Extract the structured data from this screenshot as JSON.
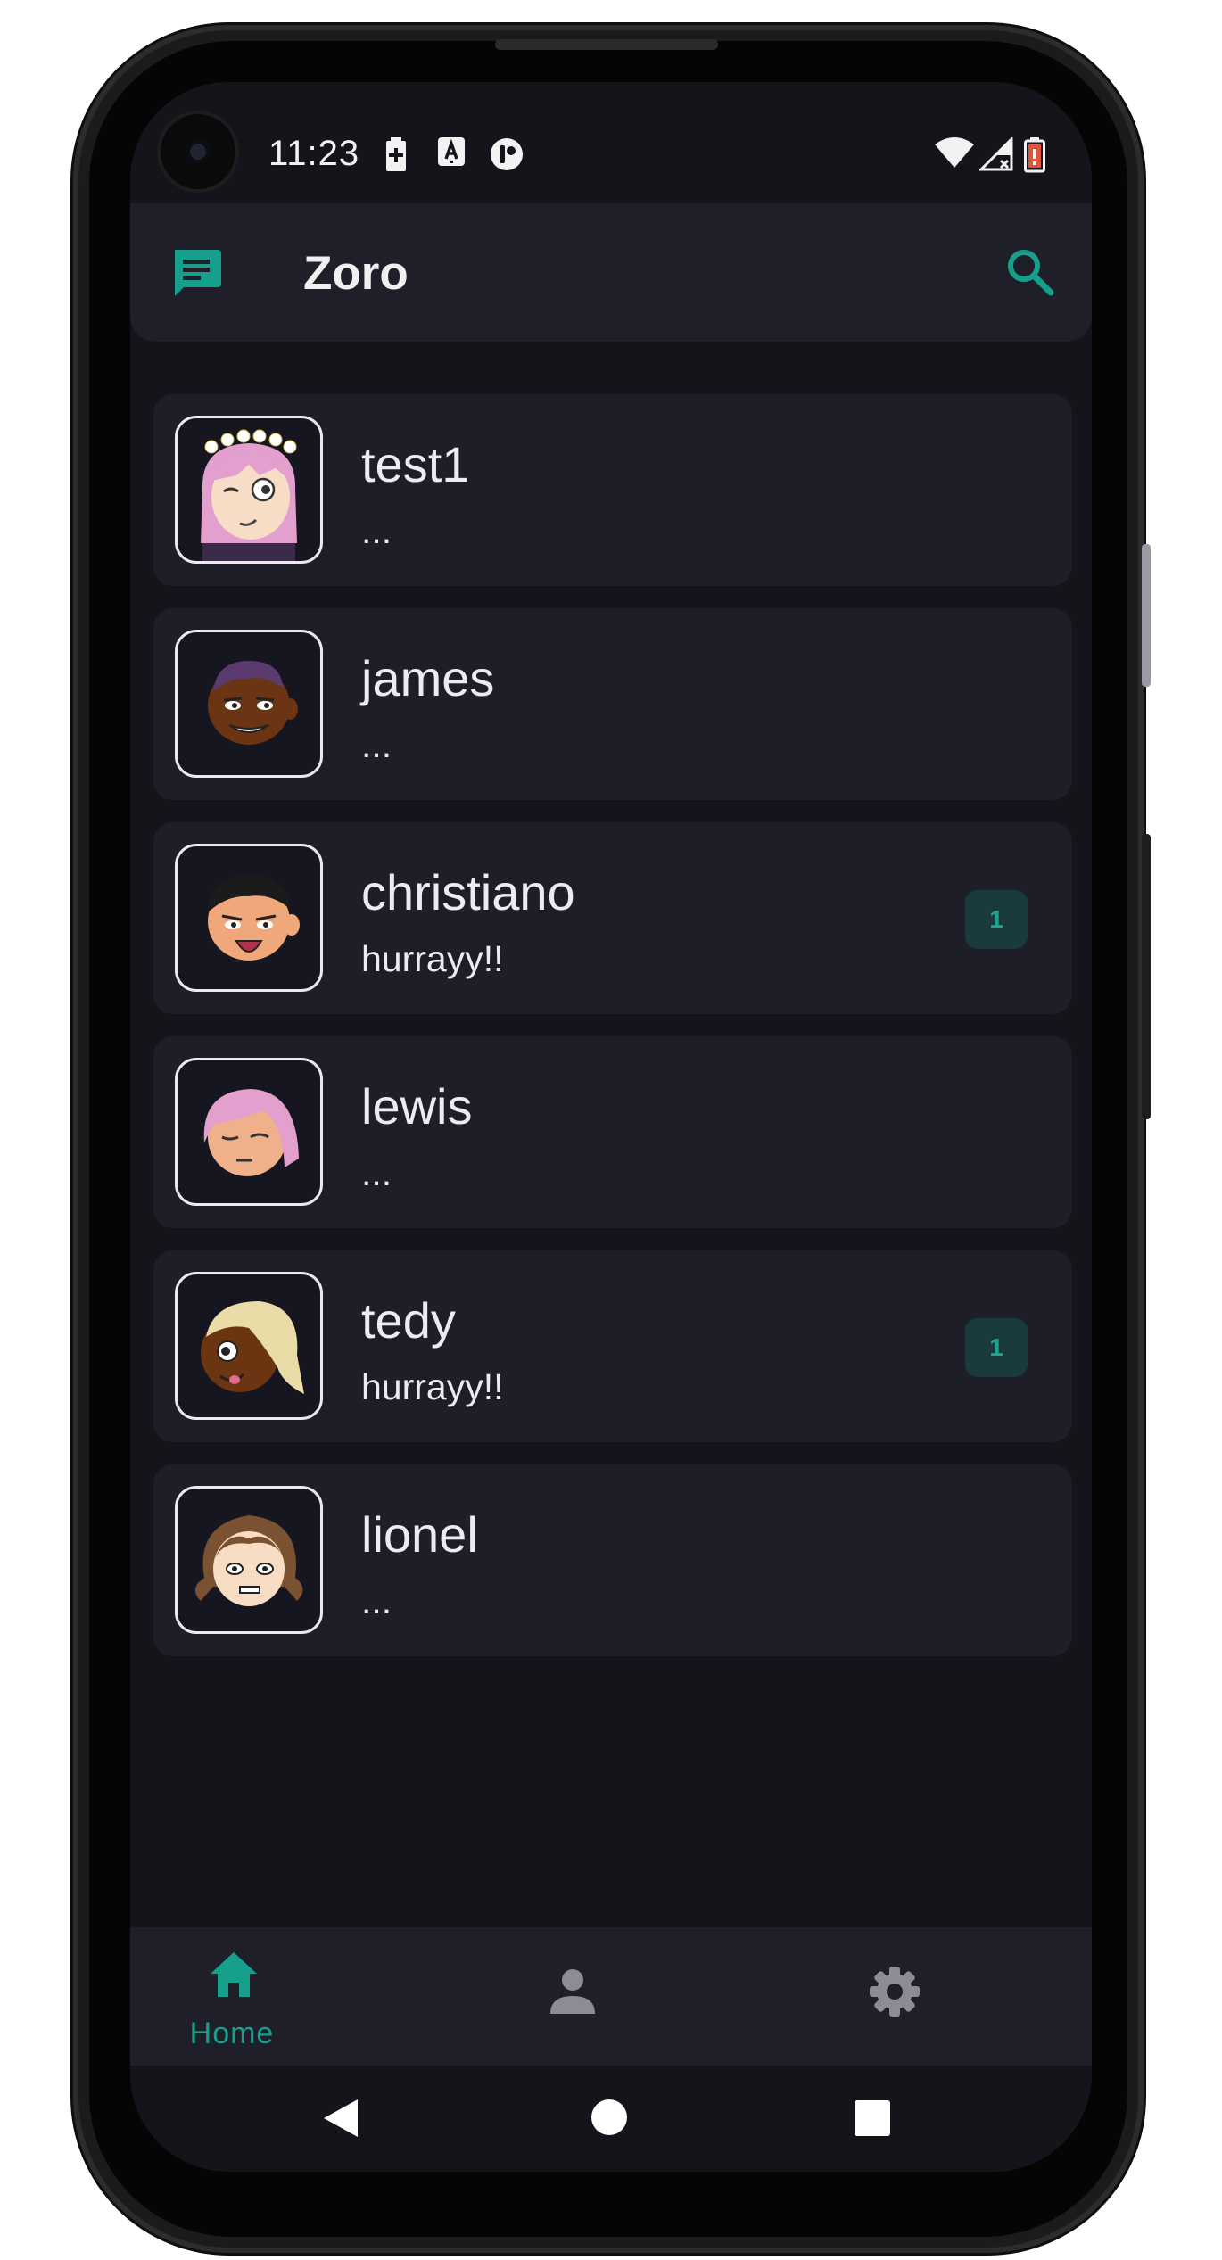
{
  "status_bar": {
    "time": "11:23"
  },
  "app_bar": {
    "title": "Zoro"
  },
  "chats": [
    {
      "name": "test1",
      "preview": "...",
      "unread": ""
    },
    {
      "name": "james",
      "preview": "...",
      "unread": ""
    },
    {
      "name": "christiano",
      "preview": "hurrayy!!",
      "unread": "1"
    },
    {
      "name": "lewis",
      "preview": "...",
      "unread": ""
    },
    {
      "name": "tedy",
      "preview": "hurrayy!!",
      "unread": "1"
    },
    {
      "name": "lionel",
      "preview": "...",
      "unread": ""
    }
  ],
  "bottom_nav": {
    "home_label": "Home"
  },
  "icons": {
    "logo": "chat-bubble-icon",
    "search": "search-icon",
    "home": "home-icon",
    "profile": "person-icon",
    "settings": "gear-icon",
    "back": "back-triangle-icon",
    "home_circle": "home-circle-icon",
    "recents": "recents-square-icon"
  },
  "colors": {
    "accent": "#16a08b",
    "background": "#14141b",
    "card": "#1e1e29",
    "badge_bg": "#1b3a3b"
  }
}
